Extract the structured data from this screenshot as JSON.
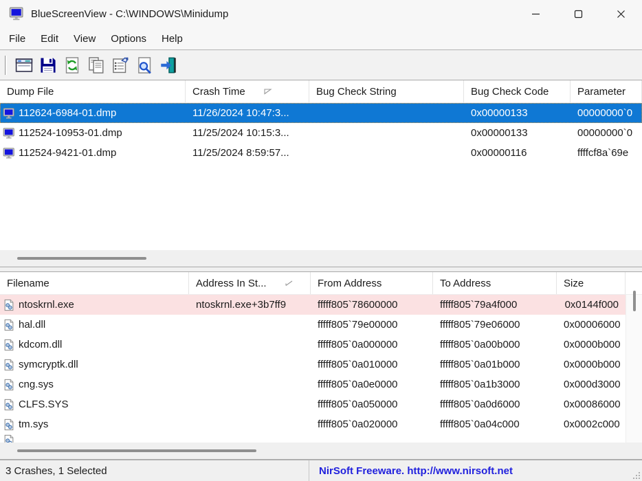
{
  "window": {
    "title": "BlueScreenView - C:\\WINDOWS\\Minidump"
  },
  "menu": {
    "items": [
      "File",
      "Edit",
      "View",
      "Options",
      "Help"
    ]
  },
  "toolbar": {
    "buttons": [
      {
        "name": "advanced-options",
        "icon": "advanced-options"
      },
      {
        "name": "save",
        "icon": "save"
      },
      {
        "name": "refresh",
        "icon": "refresh"
      },
      {
        "name": "copy-selected",
        "icon": "copy"
      },
      {
        "name": "properties",
        "icon": "properties"
      },
      {
        "name": "find",
        "icon": "find"
      },
      {
        "name": "exit",
        "icon": "exit"
      }
    ]
  },
  "upper_table": {
    "columns": [
      "Dump File",
      "Crash Time",
      "Bug Check String",
      "Bug Check Code",
      "Parameter"
    ],
    "sort": {
      "column": "Crash Time",
      "direction": "desc"
    },
    "rows": [
      {
        "dump_file": "112624-6984-01.dmp",
        "crash_time": "11/26/2024 10:47:3...",
        "bug_check_string": "",
        "bug_check_code": "0x00000133",
        "parameter_1": "00000000`0",
        "selected": true
      },
      {
        "dump_file": "112524-10953-01.dmp",
        "crash_time": "11/25/2024 10:15:3...",
        "bug_check_string": "",
        "bug_check_code": "0x00000133",
        "parameter_1": "00000000`0",
        "selected": false
      },
      {
        "dump_file": "112524-9421-01.dmp",
        "crash_time": "11/25/2024 8:59:57...",
        "bug_check_string": "",
        "bug_check_code": "0x00000116",
        "parameter_1": "ffffcf8a`69e",
        "selected": false
      }
    ]
  },
  "lower_table": {
    "columns": [
      "Filename",
      "Address In St...",
      "From Address",
      "To Address",
      "Size"
    ],
    "sort": {
      "column": "Address In St...",
      "direction": "asc"
    },
    "rows": [
      {
        "filename": "ntoskrnl.exe",
        "address_in_stack": "ntoskrnl.exe+3b7ff9",
        "from_address": "fffff805`78600000",
        "to_address": "fffff805`79a4f000",
        "size": "0x0144f000",
        "highlighted": true
      },
      {
        "filename": "hal.dll",
        "address_in_stack": "",
        "from_address": "fffff805`79e00000",
        "to_address": "fffff805`79e06000",
        "size": "0x00006000",
        "highlighted": false
      },
      {
        "filename": "kdcom.dll",
        "address_in_stack": "",
        "from_address": "fffff805`0a000000",
        "to_address": "fffff805`0a00b000",
        "size": "0x0000b000",
        "highlighted": false
      },
      {
        "filename": "symcryptk.dll",
        "address_in_stack": "",
        "from_address": "fffff805`0a010000",
        "to_address": "fffff805`0a01b000",
        "size": "0x0000b000",
        "highlighted": false
      },
      {
        "filename": "cng.sys",
        "address_in_stack": "",
        "from_address": "fffff805`0a0e0000",
        "to_address": "fffff805`0a1b3000",
        "size": "0x000d3000",
        "highlighted": false
      },
      {
        "filename": "CLFS.SYS",
        "address_in_stack": "",
        "from_address": "fffff805`0a050000",
        "to_address": "fffff805`0a0d6000",
        "size": "0x00086000",
        "highlighted": false
      },
      {
        "filename": "tm.sys",
        "address_in_stack": "",
        "from_address": "fffff805`0a020000",
        "to_address": "fffff805`0a04c000",
        "size": "0x0002c000",
        "highlighted": false
      }
    ]
  },
  "statusbar": {
    "left": "3 Crashes, 1 Selected",
    "right": "NirSoft Freeware.  http://www.nirsoft.net"
  },
  "colors": {
    "selection_blue": "#0f78d4",
    "highlight_pink": "#fbe1e2",
    "link_blue": "#2121dd",
    "dump_icon_blue": "#1515dd"
  }
}
